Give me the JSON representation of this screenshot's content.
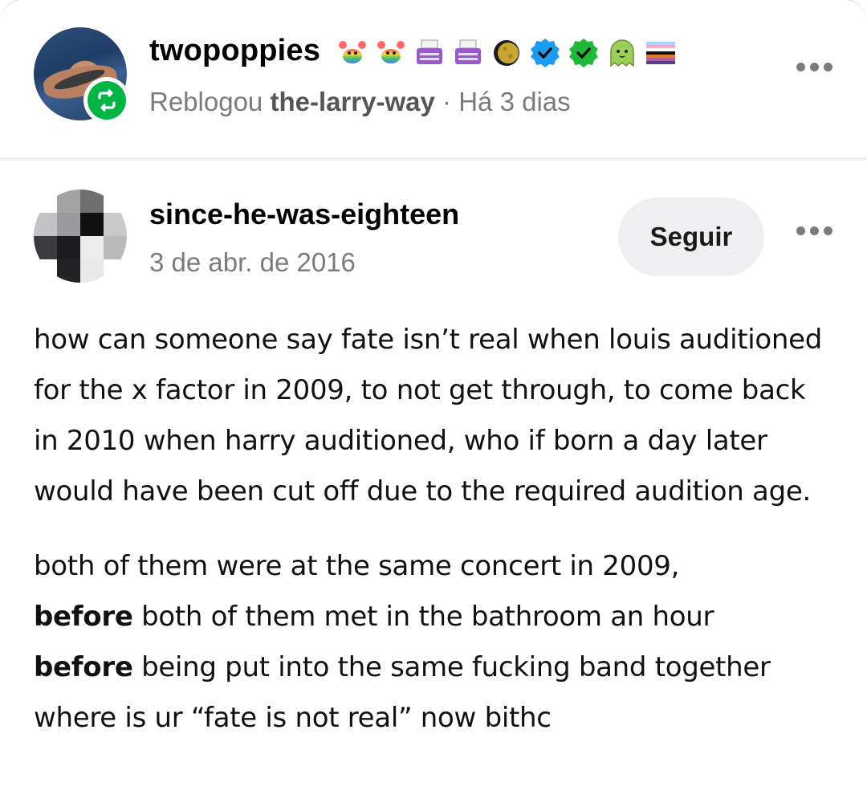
{
  "reblog_header": {
    "username": "twopoppies",
    "action": "Reblogou",
    "source_blog": "the-larry-way",
    "separator": "·",
    "time": "Há 3 dias",
    "badges": [
      "crab-rainbow-icon",
      "crab-rainbow-icon",
      "typewriter-icon",
      "typewriter-icon",
      "moon-icon",
      "verified-blue-icon",
      "verified-green-icon",
      "ghost-icon",
      "pride-flag-icon"
    ]
  },
  "post": {
    "author": "since-he-was-eighteen",
    "date": "3 de abr. de 2016",
    "follow_label": "Seguir",
    "paragraph1": "how can someone say fate isn’t real when louis auditioned for the x factor in 2009, to not get through, to come back in 2010 when harry auditioned, who if born a day later would have been cut off due to the required audition age.",
    "paragraph2_part1": "both of them were at the same concert in 2009,",
    "paragraph2_bold1": "before",
    "paragraph2_part2": " both of them met in the bathroom an hour",
    "paragraph2_bold2": "before",
    "paragraph2_part3": " being put into the same fucking band together where is ur “fate is not real” now bithc"
  },
  "colors": {
    "reblog_green": "#00b545",
    "verified_blue": "#1d9bf0",
    "muted_text": "#7b7b7b",
    "button_bg": "#efeff1"
  }
}
